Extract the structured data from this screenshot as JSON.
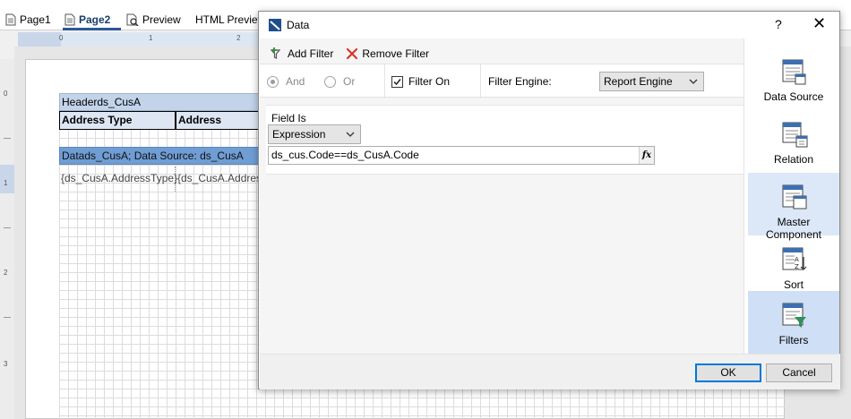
{
  "designer": {
    "tabs": [
      {
        "label": "Page1",
        "icon": "page-icon"
      },
      {
        "label": "Page2",
        "icon": "page-icon"
      },
      {
        "label": "Preview",
        "icon": "preview-icon"
      },
      {
        "label": "HTML Preview",
        "icon": "html-preview-icon"
      }
    ],
    "ruler_h_labels": [
      "0",
      "1",
      "2"
    ],
    "ruler_v_labels": [
      "0",
      "1",
      "2",
      "3"
    ],
    "header_band": "Headerds_CusA",
    "header_cells": [
      "Address Type",
      "Address"
    ],
    "data_band": "Datads_CusA; Data Source: ds_CusA",
    "data_cells": [
      "{ds_CusA.AddressType}",
      "{ds_CusA.Address"
    ]
  },
  "dialog": {
    "title": "Data",
    "help_label": "?",
    "close_label": "✕",
    "toolbar": {
      "add_filter": "Add Filter",
      "remove_filter": "Remove Filter"
    },
    "options": {
      "and_label": "And",
      "or_label": "Or",
      "filter_on_label": "Filter On",
      "filter_on_checked": true,
      "filter_engine_label": "Filter Engine:",
      "filter_engine_value": "Report Engine"
    },
    "filter": {
      "field_is_label": "Field Is",
      "field_is_value": "Expression",
      "expression": "ds_cus.Code==ds_CusA.Code",
      "fx_label": "fx"
    },
    "nav": [
      {
        "label": "Data Source",
        "icon": "data-source-icon",
        "selected": false
      },
      {
        "label": "Relation",
        "icon": "relation-icon",
        "selected": false
      },
      {
        "label": "Master Component",
        "icon": "master-component-icon",
        "selected": false
      },
      {
        "label": "Sort",
        "icon": "sort-icon",
        "selected": false
      },
      {
        "label": "Filters",
        "icon": "filters-icon",
        "selected": true
      }
    ],
    "ok_label": "OK",
    "cancel_label": "Cancel"
  },
  "colors": {
    "accent": "#0078d7",
    "nav_selected": "#cfdff5",
    "data_band": "#6f9dd4",
    "header_band": "#c3d3ea"
  }
}
